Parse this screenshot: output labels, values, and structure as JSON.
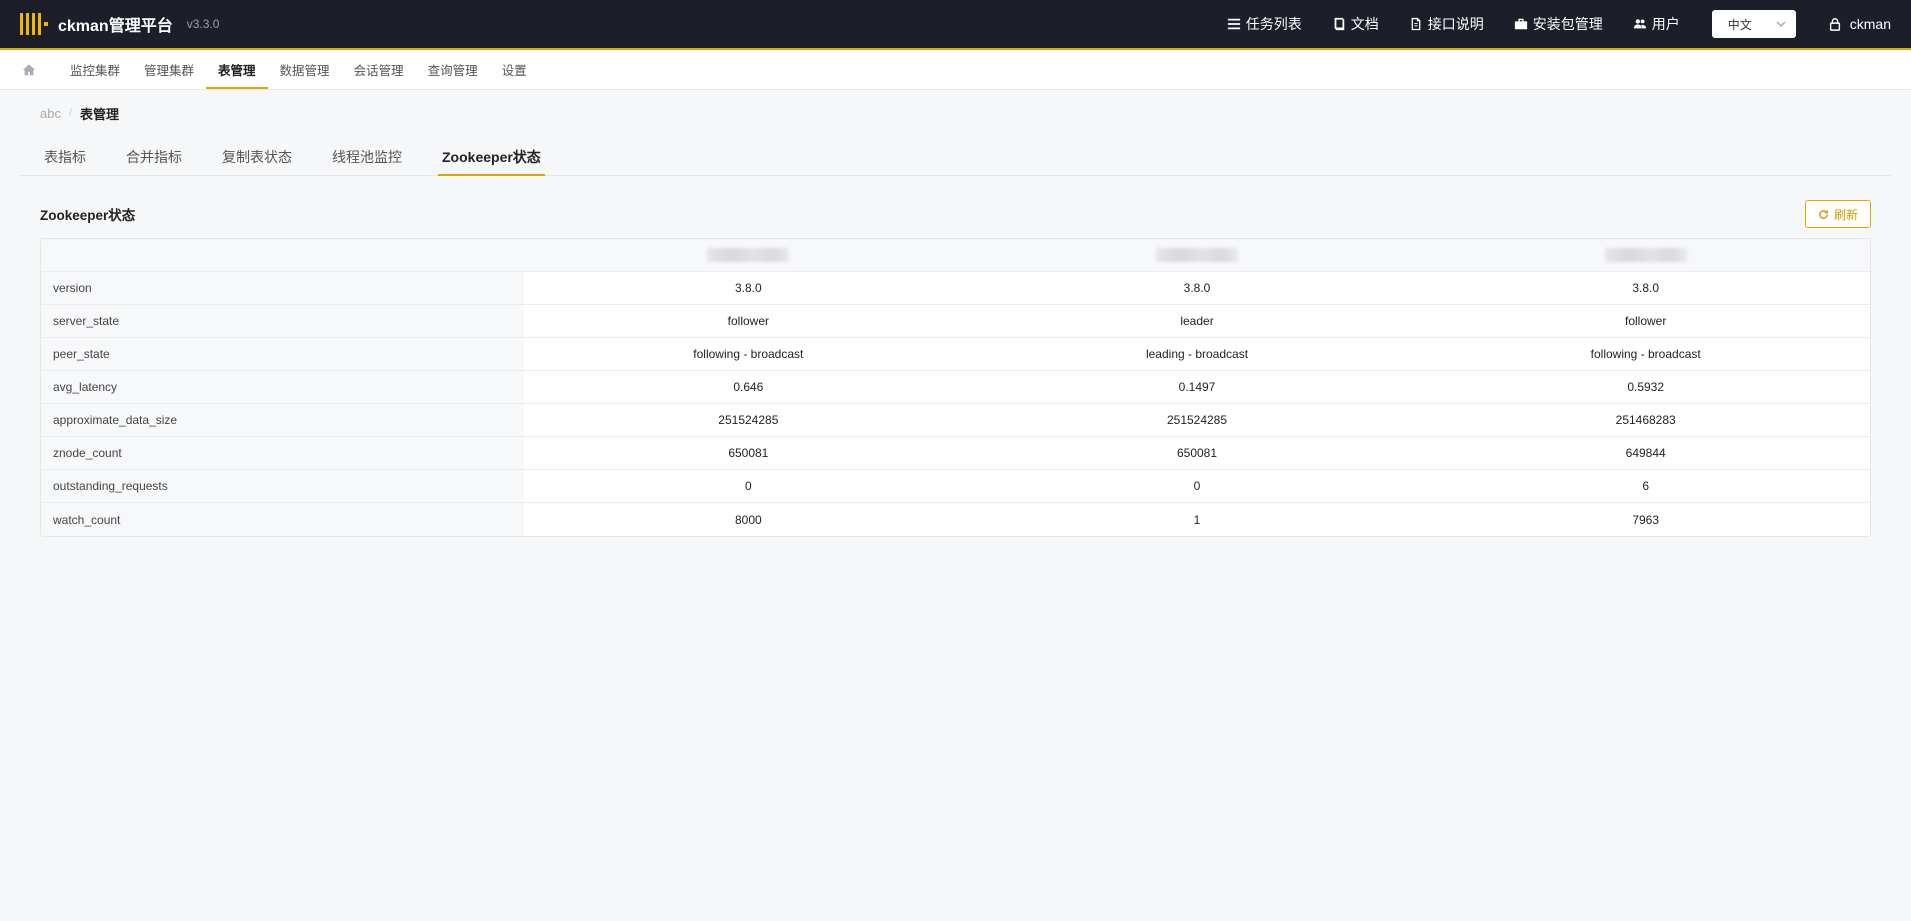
{
  "app": {
    "brand": "ckman管理平台",
    "version": "v3.3.0"
  },
  "topnav": {
    "links": [
      {
        "label": "任务列表",
        "icon": "list-icon"
      },
      {
        "label": "文档",
        "icon": "book-icon"
      },
      {
        "label": "接口说明",
        "icon": "file-icon"
      },
      {
        "label": "安装包管理",
        "icon": "briefcase-icon"
      },
      {
        "label": "用户",
        "icon": "users-icon"
      }
    ],
    "language": "中文",
    "user": "ckman"
  },
  "nav": {
    "items": [
      "监控集群",
      "管理集群",
      "表管理",
      "数据管理",
      "会话管理",
      "查询管理",
      "设置"
    ],
    "active": "表管理"
  },
  "breadcrumb": {
    "root": "abc",
    "current": "表管理"
  },
  "tabs": {
    "items": [
      "表指标",
      "合并指标",
      "复制表状态",
      "线程池监控",
      "Zookeeper状态"
    ],
    "active": "Zookeeper状态"
  },
  "section": {
    "title": "Zookeeper状态",
    "refresh_label": "刷新"
  },
  "table": {
    "rows": [
      {
        "label": "version",
        "values": [
          "3.8.0",
          "3.8.0",
          "3.8.0"
        ]
      },
      {
        "label": "server_state",
        "values": [
          "follower",
          "leader",
          "follower"
        ]
      },
      {
        "label": "peer_state",
        "values": [
          "following - broadcast",
          "leading - broadcast",
          "following - broadcast"
        ]
      },
      {
        "label": "avg_latency",
        "values": [
          "0.646",
          "0.1497",
          "0.5932"
        ]
      },
      {
        "label": "approximate_data_size",
        "values": [
          "251524285",
          "251524285",
          "251468283"
        ]
      },
      {
        "label": "znode_count",
        "values": [
          "650081",
          "650081",
          "649844"
        ]
      },
      {
        "label": "outstanding_requests",
        "values": [
          "0",
          "0",
          "6"
        ]
      },
      {
        "label": "watch_count",
        "values": [
          "8000",
          "1",
          "7963"
        ]
      }
    ]
  },
  "colors": {
    "accent": "#e0a600",
    "topbar": "#1c1f2a"
  }
}
